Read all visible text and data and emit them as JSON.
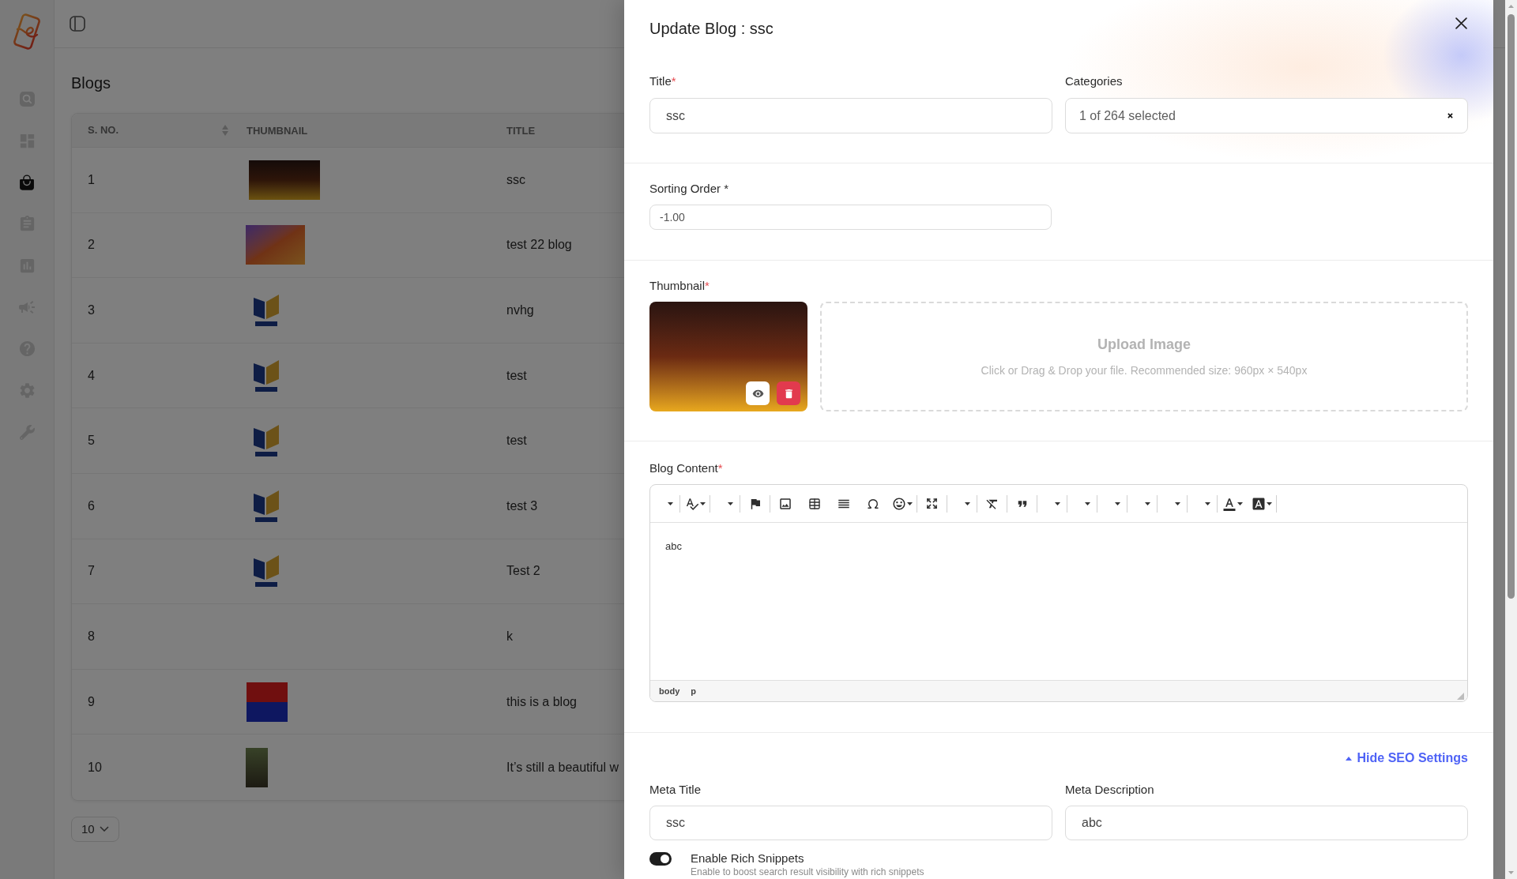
{
  "sidebar": {
    "items": [
      {
        "kind": "search",
        "selected": false
      },
      {
        "kind": "dashboard",
        "selected": false
      },
      {
        "kind": "bag",
        "selected": true
      },
      {
        "kind": "clipboard",
        "selected": false
      },
      {
        "kind": "chart",
        "selected": false
      },
      {
        "kind": "megaphone",
        "selected": false
      },
      {
        "kind": "help",
        "selected": false
      },
      {
        "kind": "settings",
        "selected": false
      },
      {
        "kind": "wrench",
        "selected": false
      }
    ]
  },
  "page": {
    "title": "Blogs"
  },
  "table": {
    "columns": [
      {
        "label": "S. NO.",
        "sortable": true
      },
      {
        "label": "THUMBNAIL",
        "sortable": false
      },
      {
        "label": "TITLE",
        "sortable": false
      }
    ],
    "rows": [
      {
        "s_no": "1",
        "thumbnail": {
          "kind": "banner"
        },
        "title": "ssc"
      },
      {
        "s_no": "2",
        "thumbnail": {
          "kind": "landscape"
        },
        "title": "test 22 blog"
      },
      {
        "s_no": "3",
        "thumbnail": {
          "kind": "logo"
        },
        "title": "nvhg"
      },
      {
        "s_no": "4",
        "thumbnail": {
          "kind": "logo"
        },
        "title": "test"
      },
      {
        "s_no": "5",
        "thumbnail": {
          "kind": "logo"
        },
        "title": "test"
      },
      {
        "s_no": "6",
        "thumbnail": {
          "kind": "logo"
        },
        "title": "test 3"
      },
      {
        "s_no": "7",
        "thumbnail": {
          "kind": "logo"
        },
        "title": "Test 2"
      },
      {
        "s_no": "8",
        "title": "k"
      },
      {
        "s_no": "9",
        "thumbnail": {
          "kind": "poster"
        },
        "title": "this is a blog"
      },
      {
        "s_no": "10",
        "thumbnail": {
          "kind": "portrait"
        },
        "title": "It’s still a beautiful w"
      }
    ]
  },
  "pagination": {
    "page_size": "10"
  },
  "drawer": {
    "title": "Update Blog : ssc",
    "title_field": {
      "label": "Title",
      "required_mark": "*",
      "value": "ssc"
    },
    "categories": {
      "label": "Categories",
      "value": "1 of 264 selected"
    },
    "sorting_order": {
      "label": "Sorting Order *",
      "value": "-1.00"
    },
    "thumbnail": {
      "label": "Thumbnail",
      "required_mark": "*",
      "upload_title": "Upload Image",
      "upload_hint": "Click or Drag & Drop your file. Recommended size: 960px × 540px"
    },
    "blog_content": {
      "label": "Blog Content",
      "required_mark": "*",
      "text": "abc",
      "path": [
        "body",
        "p"
      ]
    },
    "seo": {
      "toggle": {
        "label": "Hide SEO Settings",
        "expanded": true
      },
      "meta_title": {
        "label": "Meta Title",
        "value": "ssc"
      },
      "meta_description": {
        "label": "Meta Description",
        "value": "abc"
      },
      "rich_snippets": {
        "label": "Enable Rich Snippets",
        "on": true,
        "description": "Enable to boost search result visibility with rich snippets"
      }
    }
  }
}
